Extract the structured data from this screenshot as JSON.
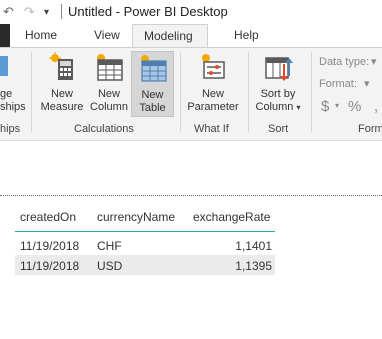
{
  "titlebar": {
    "title": "Untitled - Power BI Desktop"
  },
  "tabs": [
    "Home",
    "View",
    "Modeling",
    "Help"
  ],
  "active_tab": "Modeling",
  "ribbon": {
    "relationships_partial": {
      "label_line1": "ge",
      "label_line2": "ships",
      "group_label": "hips"
    },
    "calculations": {
      "group_label": "Calculations",
      "new_measure": {
        "line1": "New",
        "line2": "Measure"
      },
      "new_column": {
        "line1": "New",
        "line2": "Column"
      },
      "new_table": {
        "line1": "New",
        "line2": "Table"
      }
    },
    "what_if": {
      "group_label": "What If",
      "new_parameter": {
        "line1": "New",
        "line2": "Parameter"
      }
    },
    "sort": {
      "group_label": "Sort",
      "sort_by_column": {
        "line1": "Sort by",
        "line2": "Column"
      }
    },
    "formatting": {
      "group_label": "Form",
      "data_type_label": "Data type:",
      "format_label": "Format:",
      "currency_symbol": "$",
      "percent_symbol": "%",
      "comma_symbol": ","
    }
  },
  "table": {
    "columns": [
      "createdOn",
      "currencyName",
      "exchangeRate"
    ],
    "rows": [
      [
        "11/19/2018",
        "CHF",
        "1,1401"
      ],
      [
        "11/19/2018",
        "USD",
        "1,1395"
      ]
    ]
  },
  "colors": {
    "accent_teal": "#20b2a4",
    "chart_orange": "#f2a900",
    "sort_red": "#e04a2a"
  }
}
